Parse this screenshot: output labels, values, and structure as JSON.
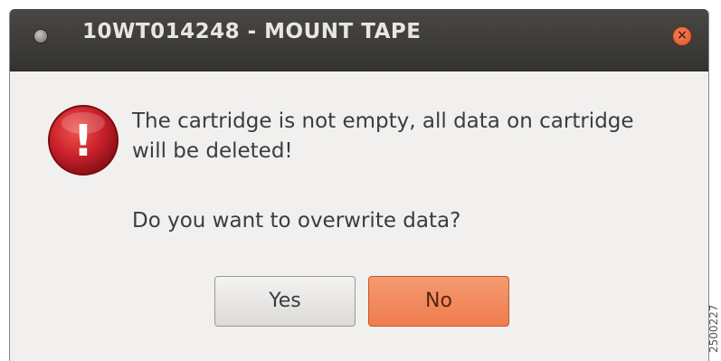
{
  "window": {
    "title": "10WT014248 - MOUNT TAPE",
    "close_symbol": "×",
    "window_icon": "window-dot-icon",
    "close_icon": "close-icon"
  },
  "dialog": {
    "icon": "warning-icon",
    "icon_glyph": "!",
    "message": "The cartridge is not empty, all data on cartridge will be deleted!",
    "question": "Do you want to overwrite data?"
  },
  "buttons": {
    "yes_label": "Yes",
    "no_label": "No"
  },
  "figure_code": "2500227",
  "colors": {
    "titlebar": "#3c3b37",
    "dialog_background": "#f1f0ef",
    "default_button": "#ef7d4f",
    "warning_icon": "#c8202a"
  }
}
